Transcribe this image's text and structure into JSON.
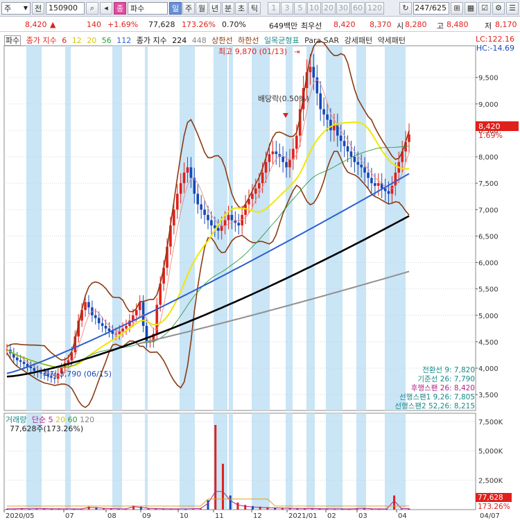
{
  "toolbar": {
    "market": "주",
    "code_type": "전",
    "code": "150900",
    "search_icon": "search-icon",
    "nav_icon": "speaker-icon",
    "name_badge": "종",
    "stock_name": "파수",
    "periods": [
      "일",
      "주",
      "월",
      "년",
      "분",
      "초",
      "틱"
    ],
    "selected_period": "일",
    "intervals": [
      "1",
      "3",
      "5",
      "10",
      "20",
      "30",
      "60",
      "120"
    ],
    "count": "247/625"
  },
  "quote": {
    "price": "8,420",
    "arrow": "▲",
    "change": "140",
    "change_pct": "+1.69%",
    "volume": "77,628",
    "volume_ratio": "173.26%",
    "turnover": "0.70%",
    "amount": "649백만",
    "best_label": "최우선",
    "ask": "8,420",
    "bid": "8,370",
    "open_label": "시",
    "open": "8,280",
    "high_label": "고",
    "high": "8,480",
    "low_label": "저",
    "low": "8,170"
  },
  "legend": {
    "title": "파수",
    "ma_label": "종가 지수",
    "ma_values": [
      "6",
      "12",
      "20",
      "56",
      "112"
    ],
    "ma2_label": "종가 지수",
    "ma2_values": [
      "224",
      "448"
    ],
    "limit_label": "상한선",
    "limit2_label": "하한선",
    "ichimoku": "일목균형표",
    "psar": "Para SAR",
    "strong": "강세패턴",
    "weak": "약세패턴"
  },
  "hl": {
    "lc": "LC:122.16",
    "hc": "HC:-14.69"
  },
  "annotations": {
    "high": "최고 9,870 (01/13)",
    "low": "최저 3,790 (06/15)",
    "dividend": "배당락(0.50%)"
  },
  "price_tag": {
    "value": "8,420",
    "pct": "1.69%"
  },
  "volume_tag": {
    "value": "77,628",
    "pct": "173.26%"
  },
  "ichimoku_values": [
    {
      "label": "전환선 9: 7,820",
      "color": "#1a8a8a"
    },
    {
      "label": "기준선 26: 7,790",
      "color": "#1a8a8a"
    },
    {
      "label": "후행스팬 26: 8,420",
      "color": "#b2248a"
    },
    {
      "label": "선행스팬1 9,26: 7,805",
      "color": "#1a8a8a"
    },
    {
      "label": "선행스팬2 52,26: 8,215",
      "color": "#1a8a8a"
    }
  ],
  "volume_legend": {
    "label": "거래량",
    "ma_label": "단순",
    "ma_values": [
      "5",
      "20",
      "60",
      "120"
    ],
    "current": "77,628주(173.26%)"
  },
  "colors": {
    "up": "#e0201c",
    "down": "#1747b8",
    "stripe": "#bfe0f5",
    "bollinger": "#8a3a10",
    "ma_yellow": "#f2e600",
    "ma_green": "#2e9a40",
    "ma_blue": "#2a5fd0",
    "ma_black": "#000000",
    "ma_gray": "#909090"
  },
  "chart_data": {
    "type": "candlestick",
    "x_ticks": [
      "2020/05",
      "07",
      "08",
      "09",
      "10",
      "11",
      "12",
      "2021/01",
      "02",
      "03",
      "04"
    ],
    "y_ticks": [
      "9,500",
      "9,000",
      "8,500",
      "8,000",
      "7,500",
      "7,000",
      "6,500",
      "6,000",
      "5,500",
      "5,000",
      "4,500",
      "4,000",
      "3,500"
    ],
    "ylim": [
      3200,
      10100
    ],
    "volume_ticks": [
      "7,500K",
      "5,000K",
      "2,500K"
    ],
    "volume_ylim": [
      0,
      8200000
    ],
    "last_x_tick": "04/07",
    "candles_close": [
      4350,
      4280,
      4200,
      4150,
      4120,
      4080,
      4030,
      4000,
      3950,
      3920,
      3900,
      3880,
      3850,
      3820,
      3800,
      3900,
      4000,
      4100,
      4150,
      4300,
      4600,
      4900,
      5100,
      5250,
      5150,
      5000,
      4950,
      4850,
      4800,
      4750,
      4700,
      4650,
      4650,
      4700,
      4750,
      4800,
      4900,
      5000,
      5100,
      5250,
      4800,
      4500,
      4500,
      4650,
      5200,
      5600,
      5900,
      6300,
      6700,
      7000,
      7300,
      7500,
      7700,
      7800,
      7600,
      7300,
      7100,
      7000,
      6900,
      6800,
      6700,
      6650,
      6600,
      6700,
      6800,
      6900,
      6800,
      6750,
      6700,
      6900,
      7100,
      7200,
      7300,
      7400,
      7500,
      7700,
      7900,
      8050,
      8100,
      8050,
      8000,
      7900,
      7800,
      7950,
      8150,
      8400,
      8900,
      9300,
      9600,
      9700,
      9500,
      9200,
      8900,
      8800,
      8700,
      8500,
      8600,
      8400,
      8300,
      8200,
      8100,
      8000,
      7900,
      7850,
      7800,
      7700,
      7600,
      7500,
      7450,
      7500,
      7400,
      7350,
      7300,
      7450,
      7700,
      7900,
      8100,
      8280,
      8420
    ],
    "volume_samples": [
      60000,
      50000,
      90000,
      45000,
      70000,
      80000,
      55000,
      60000,
      50000,
      40000,
      30000,
      250000,
      200000,
      120000,
      80000,
      60000,
      40000,
      350000,
      250000,
      120000,
      80000,
      60000,
      50000,
      40000,
      30000,
      60000,
      100000,
      800000,
      7200000,
      3900000,
      1200000,
      600000,
      400000,
      300000,
      250000,
      200000,
      180000,
      150000,
      120000,
      100000,
      90000,
      80000,
      70000,
      60000,
      50000,
      40000,
      30000,
      80000,
      120000,
      60000,
      40000,
      30000,
      1200000,
      60000,
      77628
    ]
  }
}
